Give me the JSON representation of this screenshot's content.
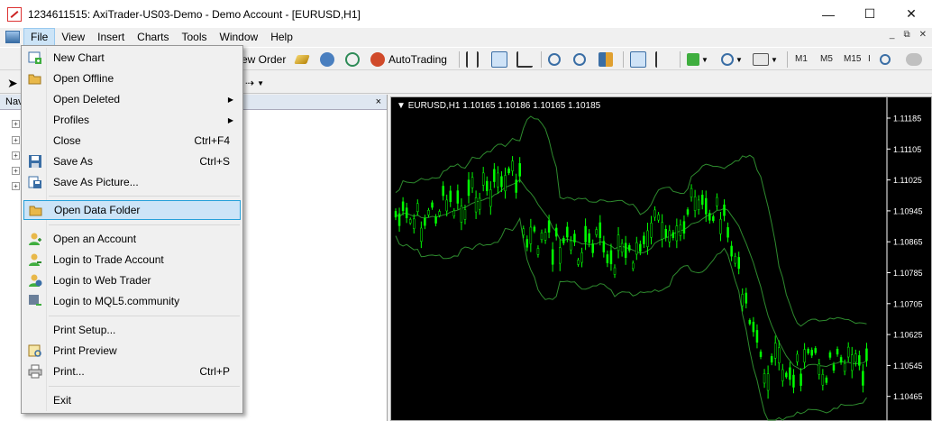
{
  "window": {
    "title": "1234611515: AxiTrader-US03-Demo - Demo Account - [EURUSD,H1]",
    "minimize": "—",
    "maximize": "☐",
    "close": "✕"
  },
  "menubar": {
    "items": [
      "File",
      "View",
      "Insert",
      "Charts",
      "Tools",
      "Window",
      "Help"
    ],
    "active": "File"
  },
  "toolbar": {
    "new_order_label": "ew Order",
    "autotrading_label": "AutoTrading",
    "timeframes": [
      "M1",
      "M5",
      "M15",
      "I"
    ]
  },
  "navigator": {
    "title": "Nav",
    "close": "×"
  },
  "chart": {
    "symbol_label": "EURUSD,H1",
    "ohlc": "1.10165 1.10186 1.10165 1.10185",
    "background": "#000000",
    "candle_color": "#00ff00",
    "band_color": "#2e8b2e",
    "price_labels": [
      "1.11185",
      "1.11105",
      "1.11025",
      "1.10945",
      "1.10865",
      "1.10785",
      "1.10705",
      "1.10625",
      "1.10545",
      "1.10465"
    ]
  },
  "file_menu": {
    "items": [
      {
        "label": "New Chart",
        "shortcut": "",
        "submenu": false,
        "icon": "new-chart-icon"
      },
      {
        "label": "Open Offline",
        "shortcut": "",
        "submenu": false,
        "icon": "open-folder-icon"
      },
      {
        "label": "Open Deleted",
        "shortcut": "",
        "submenu": true,
        "icon": ""
      },
      {
        "label": "Profiles",
        "shortcut": "",
        "submenu": true,
        "icon": ""
      },
      {
        "label": "Close",
        "shortcut": "Ctrl+F4",
        "submenu": false,
        "icon": ""
      },
      {
        "label": "Save As",
        "shortcut": "Ctrl+S",
        "submenu": false,
        "icon": "save-icon"
      },
      {
        "label": "Save As Picture...",
        "shortcut": "",
        "submenu": false,
        "icon": "save-picture-icon"
      },
      {
        "label": "Open Data Folder",
        "shortcut": "",
        "submenu": false,
        "icon": "data-folder-icon",
        "highlighted": true
      },
      {
        "label": "Open an Account",
        "shortcut": "",
        "submenu": false,
        "icon": "account-icon"
      },
      {
        "label": "Login to Trade Account",
        "shortcut": "",
        "submenu": false,
        "icon": "login-icon"
      },
      {
        "label": "Login to Web Trader",
        "shortcut": "",
        "submenu": false,
        "icon": "web-trader-icon"
      },
      {
        "label": "Login to MQL5.community",
        "shortcut": "",
        "submenu": false,
        "icon": "mql5-icon"
      },
      {
        "label": "Print Setup...",
        "shortcut": "",
        "submenu": false,
        "icon": ""
      },
      {
        "label": "Print Preview",
        "shortcut": "",
        "submenu": false,
        "icon": "print-preview-icon"
      },
      {
        "label": "Print...",
        "shortcut": "Ctrl+P",
        "submenu": false,
        "icon": "print-icon"
      },
      {
        "label": "Exit",
        "shortcut": "",
        "submenu": false,
        "icon": ""
      }
    ]
  }
}
